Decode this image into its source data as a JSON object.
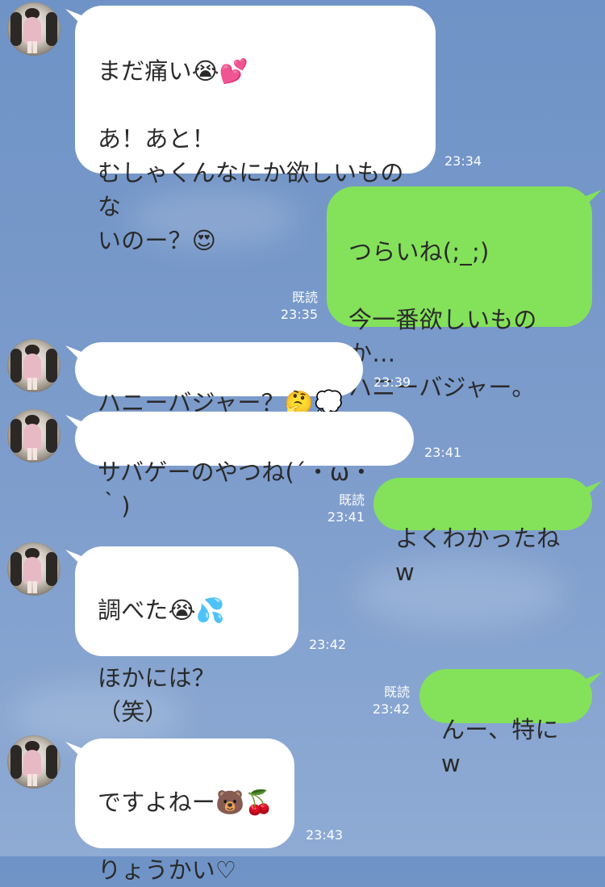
{
  "chat": {
    "messages": [
      {
        "id": "m1",
        "side": "in",
        "text": "まだ痛い😭💕\n\nあ！あと！\nむしゃくんなにか欲しいものな\nいのー？😍",
        "time": "23:34"
      },
      {
        "id": "m2",
        "side": "out",
        "text": "つらいね(;_;)\n\n今一番欲しいものか…\nハニーバジャー。",
        "read": "既読",
        "time": "23:35"
      },
      {
        "id": "m3",
        "side": "in",
        "text": "ハニーバジャー？🤔💭",
        "time": "23:39"
      },
      {
        "id": "m4",
        "side": "in",
        "text": "サバゲーのやつね(´・ω・｀)",
        "time": "23:41"
      },
      {
        "id": "m5",
        "side": "out",
        "text": "よくわかったねw",
        "read": "既読",
        "time": "23:41"
      },
      {
        "id": "m6",
        "side": "in",
        "text": "調べた😭💦\n\nほかには？（笑）",
        "time": "23:42"
      },
      {
        "id": "m7",
        "side": "out",
        "text": "んー、特にw",
        "read": "既読",
        "time": "23:42"
      },
      {
        "id": "m8",
        "side": "in",
        "text": "ですよねー🐻🍒\n\nりょうかい♡",
        "time": "23:43"
      }
    ]
  },
  "colors": {
    "background_top": "#6f93c6",
    "background_bottom": "#8eabd4",
    "incoming_bubble": "#ffffff",
    "outgoing_bubble": "#84e15a",
    "meta_text": "#ffffff"
  },
  "icons": {
    "avatar": "profile-photo-avatar"
  }
}
